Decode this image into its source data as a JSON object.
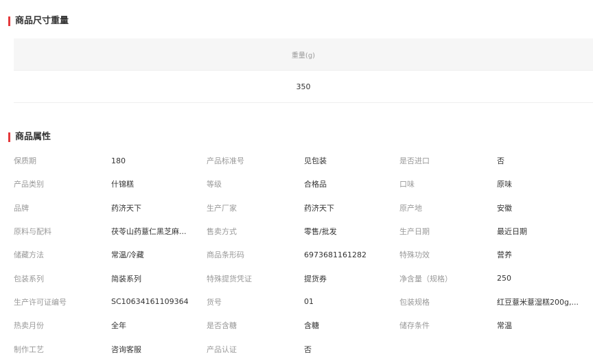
{
  "size_section": {
    "title": "商品尺寸重量",
    "header": "重量(g)",
    "value": "350"
  },
  "attr_section": {
    "title": "商品属性",
    "rows": [
      [
        {
          "label": "保质期",
          "value": "180"
        },
        {
          "label": "产品标准号",
          "value": "见包装"
        },
        {
          "label": "是否进口",
          "value": "否"
        }
      ],
      [
        {
          "label": "产品类别",
          "value": "什锦糕"
        },
        {
          "label": "等级",
          "value": "合格品"
        },
        {
          "label": "口味",
          "value": "原味"
        }
      ],
      [
        {
          "label": "品牌",
          "value": "药济天下"
        },
        {
          "label": "生产厂家",
          "value": "药济天下"
        },
        {
          "label": "原产地",
          "value": "安徽"
        }
      ],
      [
        {
          "label": "原料与配料",
          "value": "茯苓山药薏仁黑芝麻..."
        },
        {
          "label": "售卖方式",
          "value": "零售/批发"
        },
        {
          "label": "生产日期",
          "value": "最近日期"
        }
      ],
      [
        {
          "label": "储藏方法",
          "value": "常温/冷藏"
        },
        {
          "label": "商品条形码",
          "value": "6973681161282"
        },
        {
          "label": "特殊功效",
          "value": "营养"
        }
      ],
      [
        {
          "label": "包装系列",
          "value": "简装系列"
        },
        {
          "label": "特殊提货凭证",
          "value": "提货券"
        },
        {
          "label": "净含量（规格）",
          "value": "250"
        }
      ],
      [
        {
          "label": "生产许可证编号",
          "value": "SC10634161109364"
        },
        {
          "label": "货号",
          "value": "01"
        },
        {
          "label": "包装规格",
          "value": "红豆薏米薏湿糕200g,..."
        }
      ],
      [
        {
          "label": "热卖月份",
          "value": "全年"
        },
        {
          "label": "是否含糖",
          "value": "含糖"
        },
        {
          "label": "储存条件",
          "value": "常温"
        }
      ],
      [
        {
          "label": "制作工艺",
          "value": "咨询客服"
        },
        {
          "label": "产品认证",
          "value": "否"
        }
      ]
    ]
  }
}
